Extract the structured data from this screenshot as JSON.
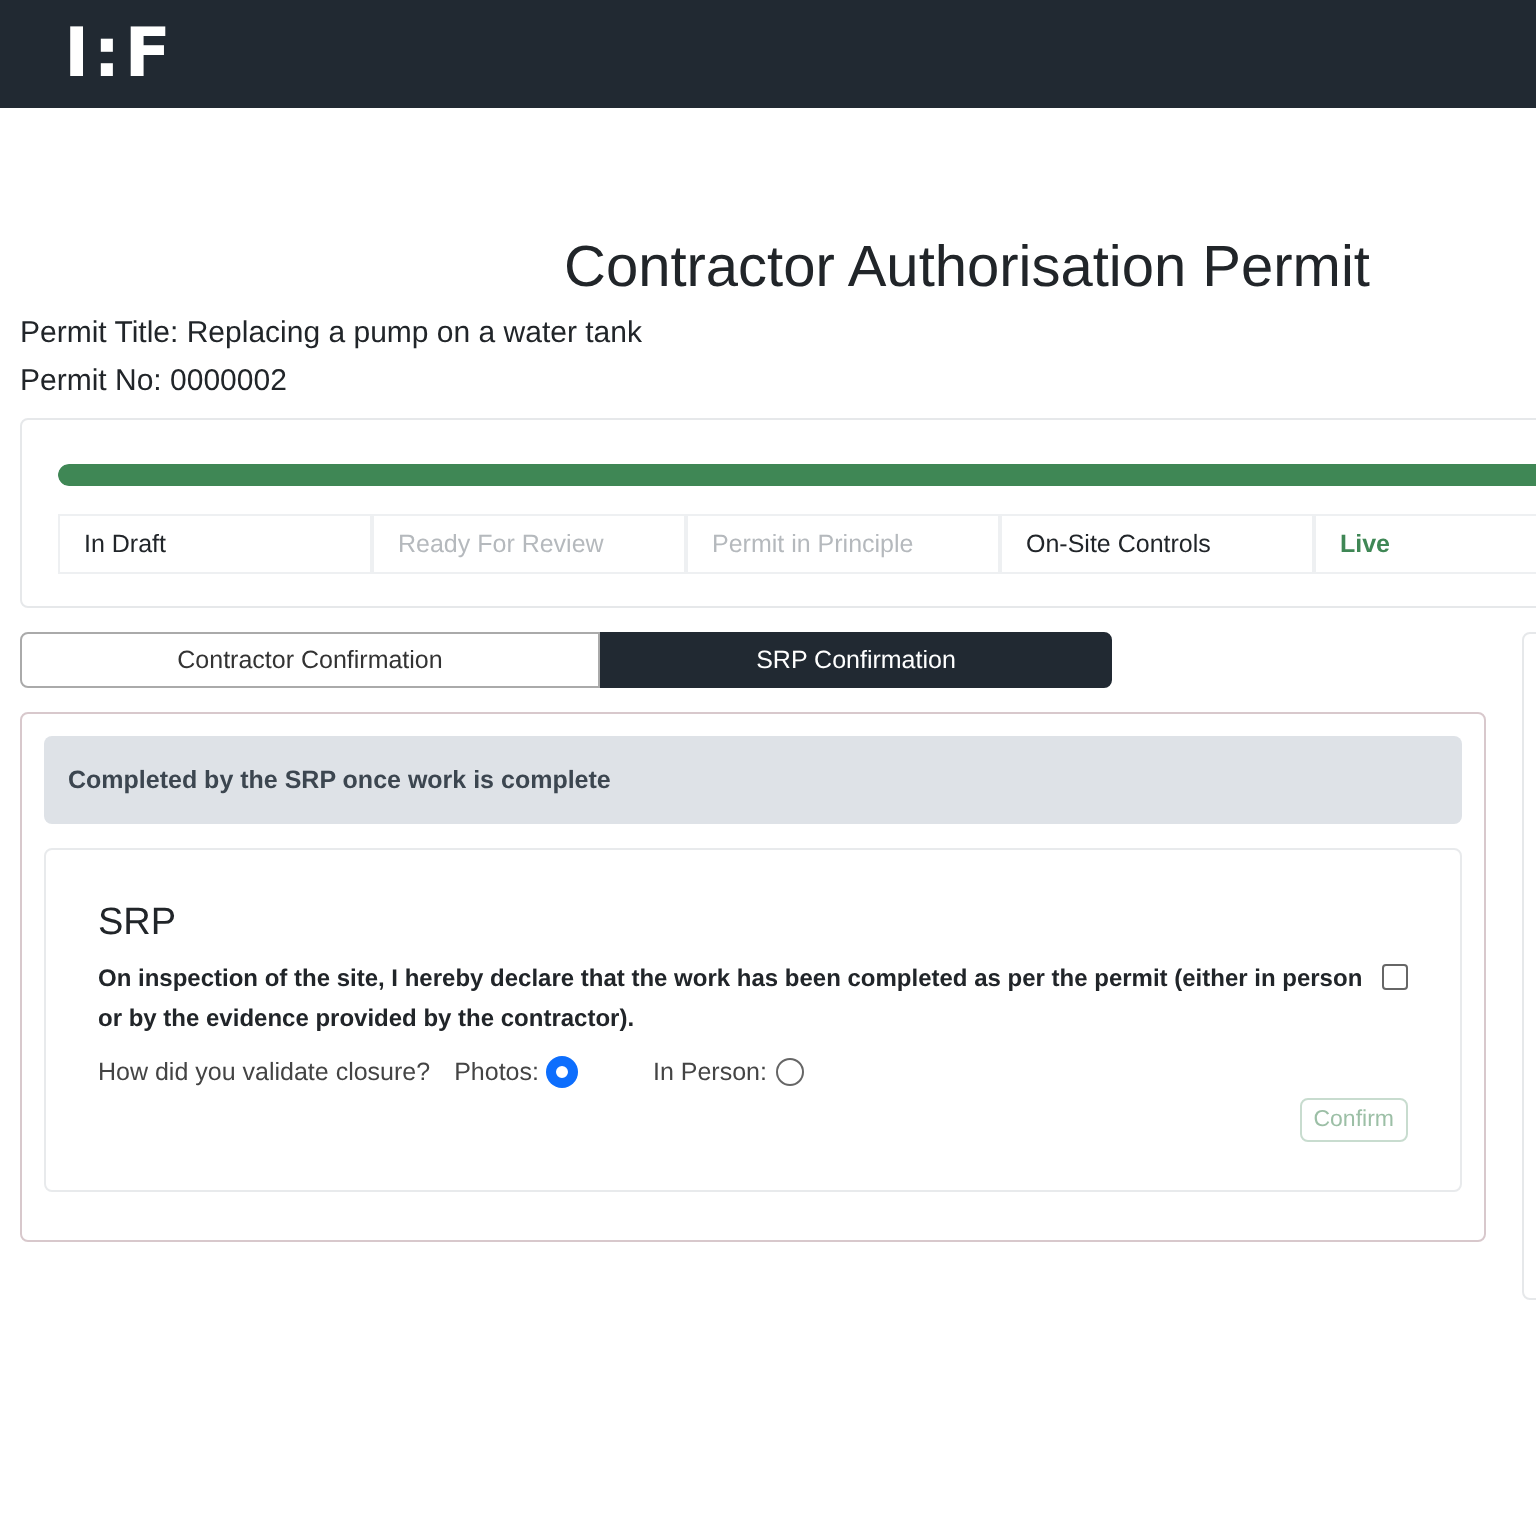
{
  "header": {
    "logo": "I:F"
  },
  "title": "Contractor Authorisation Permit",
  "permit_title": "Permit Title: Replacing a pump on a water tank",
  "permit_no": "Permit No: 0000002",
  "progress": {
    "level": 1.0
  },
  "steps": [
    {
      "label": "In Draft",
      "disabled": false,
      "selected": false
    },
    {
      "label": "Ready For Review",
      "disabled": true,
      "selected": false
    },
    {
      "label": "Permit in Principle",
      "disabled": true,
      "selected": false
    },
    {
      "label": "On-Site Controls",
      "disabled": false,
      "selected": false
    },
    {
      "label": "Live",
      "disabled": false,
      "selected": true
    }
  ],
  "tabs": [
    {
      "label": "Contractor Confirmation",
      "selected": false
    },
    {
      "label": "SRP Confirmation",
      "selected": true
    }
  ],
  "notice": "Completed by the SRP once work is complete",
  "section": {
    "heading": "SRP",
    "declaration": "On inspection of the site, I hereby declare that the work has been completed as per the permit (either in person or by the evidence provided by the contractor).",
    "declaration_checked": false,
    "question": "How did you validate closure?",
    "options": [
      {
        "label": "Photos:",
        "selected": true
      },
      {
        "label": "In Person:",
        "selected": false
      }
    ],
    "confirm": {
      "label": "Confirm",
      "disabled": true
    }
  }
}
